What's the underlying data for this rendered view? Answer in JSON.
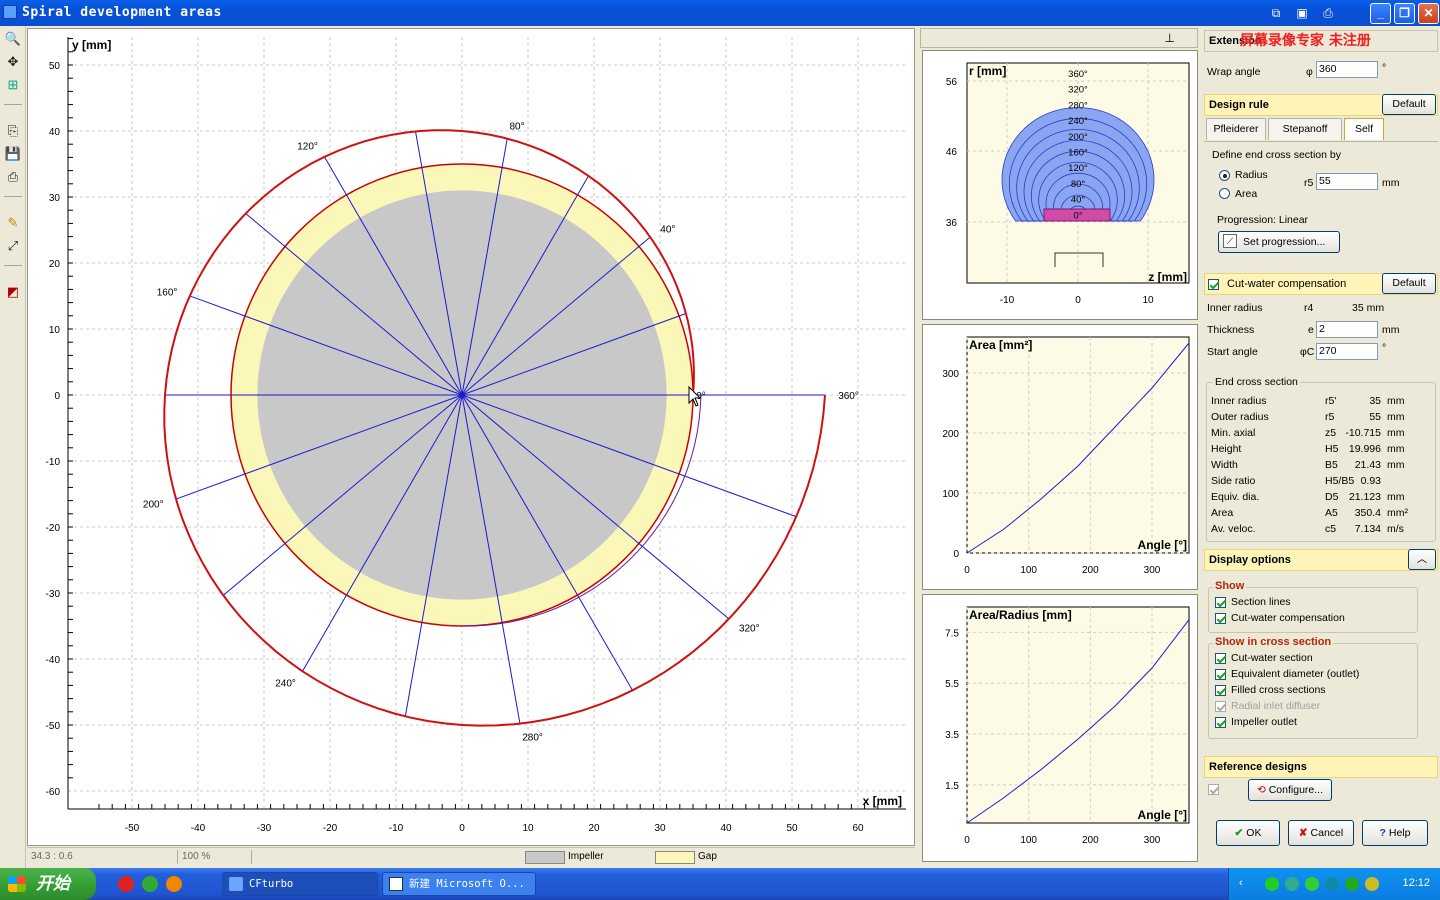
{
  "window": {
    "title": "Spiral development areas"
  },
  "watermark": "屏幕录像专家  未注册",
  "main_plot": {
    "ylabel": "y [mm]",
    "xlabel": "x [mm]",
    "x_ticks": [
      "-50",
      "-40",
      "-30",
      "-20",
      "-10",
      "0",
      "10",
      "20",
      "30",
      "40",
      "50",
      "60"
    ],
    "y_ticks": [
      "50",
      "40",
      "30",
      "20",
      "10",
      "0",
      "-10",
      "-20",
      "-30",
      "-40",
      "-50",
      "-60"
    ],
    "angle_labels": [
      "0°",
      "40°",
      "80°",
      "120°",
      "160°",
      "200°",
      "240°",
      "280°",
      "320°",
      "360°"
    ],
    "impeller_radius": 31,
    "gap_outer_radius": 35,
    "spiral": {
      "start_radius": 35,
      "end_radius": 55,
      "end_angle": 360
    }
  },
  "status": {
    "coords": "34.3 : 0.6",
    "zoom": "100 %",
    "legend_impeller": "Impeller",
    "legend_gap": "Gap",
    "impeller_color": "#c8c8c8",
    "gap_color": "#fbf7b8"
  },
  "cross_section_chart": {
    "ylabel": "r [mm]",
    "xlabel": "z [mm]",
    "y_ticks": [
      "56",
      "46",
      "36"
    ],
    "x_ticks": [
      "-10",
      "0",
      "10"
    ],
    "angle_labels": [
      "360°",
      "320°",
      "280°",
      "240°",
      "200°",
      "160°",
      "120°",
      "80°",
      "40°",
      "0°"
    ]
  },
  "chart_data": [
    {
      "type": "line",
      "title": "",
      "ylabel": "Area [mm²]",
      "xlabel": "Angle [°]",
      "x": [
        0,
        60,
        120,
        180,
        240,
        300,
        360
      ],
      "y": [
        0,
        40,
        90,
        145,
        210,
        275,
        350
      ],
      "y_ticks": [
        "300",
        "200",
        "100",
        "0"
      ],
      "x_ticks": [
        "0",
        "100",
        "200",
        "300"
      ],
      "xlim": [
        0,
        360
      ],
      "ylim": [
        0,
        360
      ]
    },
    {
      "type": "line",
      "title": "",
      "ylabel": "Area/Radius [mm]",
      "xlabel": "Angle [°]",
      "x": [
        0,
        60,
        120,
        180,
        240,
        300,
        360
      ],
      "y": [
        0,
        1.0,
        2.1,
        3.3,
        4.6,
        6.1,
        8.0
      ],
      "y_ticks": [
        "7.5",
        "5.5",
        "3.5",
        "1.5"
      ],
      "x_ticks": [
        "0",
        "100",
        "200",
        "300"
      ],
      "xlim": [
        0,
        360
      ],
      "ylim": [
        0,
        8.5
      ]
    }
  ],
  "extension": {
    "head": "Extension",
    "wrap_label": "Wrap angle",
    "wrap_sym": "φ",
    "wrap_value": "360",
    "wrap_unit": "°"
  },
  "design_rule": {
    "head": "Design rule",
    "default_btn": "Default",
    "tabs": [
      "Pfleiderer",
      "Stepanoff",
      "Self"
    ],
    "define_label": "Define end cross section by",
    "radius_label": "Radius",
    "area_label": "Area",
    "r5_sym": "r5",
    "r5_value": "55",
    "r5_unit": "mm",
    "progression_label": "Progression:  Linear",
    "set_progression_btn": "Set progression..."
  },
  "cutwater": {
    "head": "Cut-water compensation",
    "default_btn": "Default",
    "rows": [
      {
        "label": "Inner radius",
        "sym": "r4",
        "value": "35 mm"
      },
      {
        "label": "Thickness",
        "sym": "e",
        "value": "2",
        "unit": "mm"
      },
      {
        "label": "Start angle",
        "sym": "φC",
        "value": "270",
        "unit": "°"
      }
    ]
  },
  "end_cross_section": {
    "title": "End cross section",
    "rows": [
      {
        "label": "Inner radius",
        "sym": "r5'",
        "value": "35",
        "unit": "mm"
      },
      {
        "label": "Outer radius",
        "sym": "r5",
        "value": "55",
        "unit": "mm"
      },
      {
        "label": "Min. axial",
        "sym": "z5",
        "value": "-10.715",
        "unit": "mm"
      },
      {
        "label": "Height",
        "sym": "H5",
        "value": "19.996",
        "unit": "mm"
      },
      {
        "label": "Width",
        "sym": "B5",
        "value": "21.43",
        "unit": "mm"
      },
      {
        "label": "Side ratio",
        "sym": "H5/B5",
        "value": "0.93",
        "unit": ""
      },
      {
        "label": "Equiv. dia.",
        "sym": "D5",
        "value": "21.123",
        "unit": "mm"
      },
      {
        "label": "Area",
        "sym": "A5",
        "value": "350.4",
        "unit": "mm²"
      },
      {
        "label": "Av. veloc.",
        "sym": "c5",
        "value": "7.134",
        "unit": "m/s"
      }
    ]
  },
  "display_options": {
    "head": "Display options",
    "show_title": "Show",
    "show_items": [
      {
        "label": "Section lines",
        "checked": true
      },
      {
        "label": "Cut-water compensation",
        "checked": true
      }
    ],
    "cross_title": "Show in cross section",
    "cross_items": [
      {
        "label": "Cut-water section",
        "checked": true
      },
      {
        "label": "Equivalent diameter (outlet)",
        "checked": true
      },
      {
        "label": "Filled cross sections",
        "checked": true
      },
      {
        "label": "Radial inlet diffuser",
        "checked": true,
        "disabled": true
      },
      {
        "label": "Impeller outlet",
        "checked": true
      }
    ]
  },
  "reference": {
    "head": "Reference designs",
    "configure_btn": "Configure..."
  },
  "dialog_buttons": {
    "ok": "OK",
    "cancel": "Cancel",
    "help": "Help"
  },
  "taskbar": {
    "start": "开始",
    "tasks": [
      "CFturbo",
      "新建 Microsoft O..."
    ],
    "clock": "12:12"
  }
}
